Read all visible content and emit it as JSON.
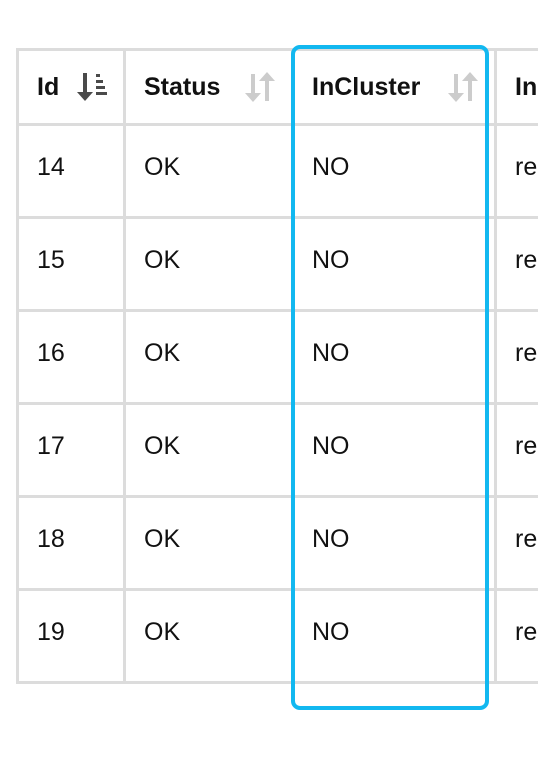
{
  "table": {
    "columns": [
      {
        "label": "Id",
        "sort": "ascending"
      },
      {
        "label": "Status",
        "sort": "none"
      },
      {
        "label": "InCluster",
        "sort": "none"
      },
      {
        "label": "In",
        "sort": "none"
      }
    ],
    "rows": [
      {
        "id": "14",
        "status": "OK",
        "in_cluster": "NO",
        "more": "re"
      },
      {
        "id": "15",
        "status": "OK",
        "in_cluster": "NO",
        "more": "re"
      },
      {
        "id": "16",
        "status": "OK",
        "in_cluster": "NO",
        "more": "re"
      },
      {
        "id": "17",
        "status": "OK",
        "in_cluster": "NO",
        "more": "re"
      },
      {
        "id": "18",
        "status": "OK",
        "in_cluster": "NO",
        "more": "re"
      },
      {
        "id": "19",
        "status": "OK",
        "in_cluster": "NO",
        "more": "re"
      }
    ]
  },
  "highlight": {
    "column": "InCluster",
    "color": "#12b8f0"
  },
  "colors": {
    "border": "#dcdcdc",
    "active_sort_icon": "#4a4a4a",
    "inactive_sort_icon": "#cccccc",
    "text": "#111111"
  },
  "icons": {
    "active_sort": "sort-numeric-ascending-icon",
    "inactive_sort": "sort-arrows-icon"
  }
}
